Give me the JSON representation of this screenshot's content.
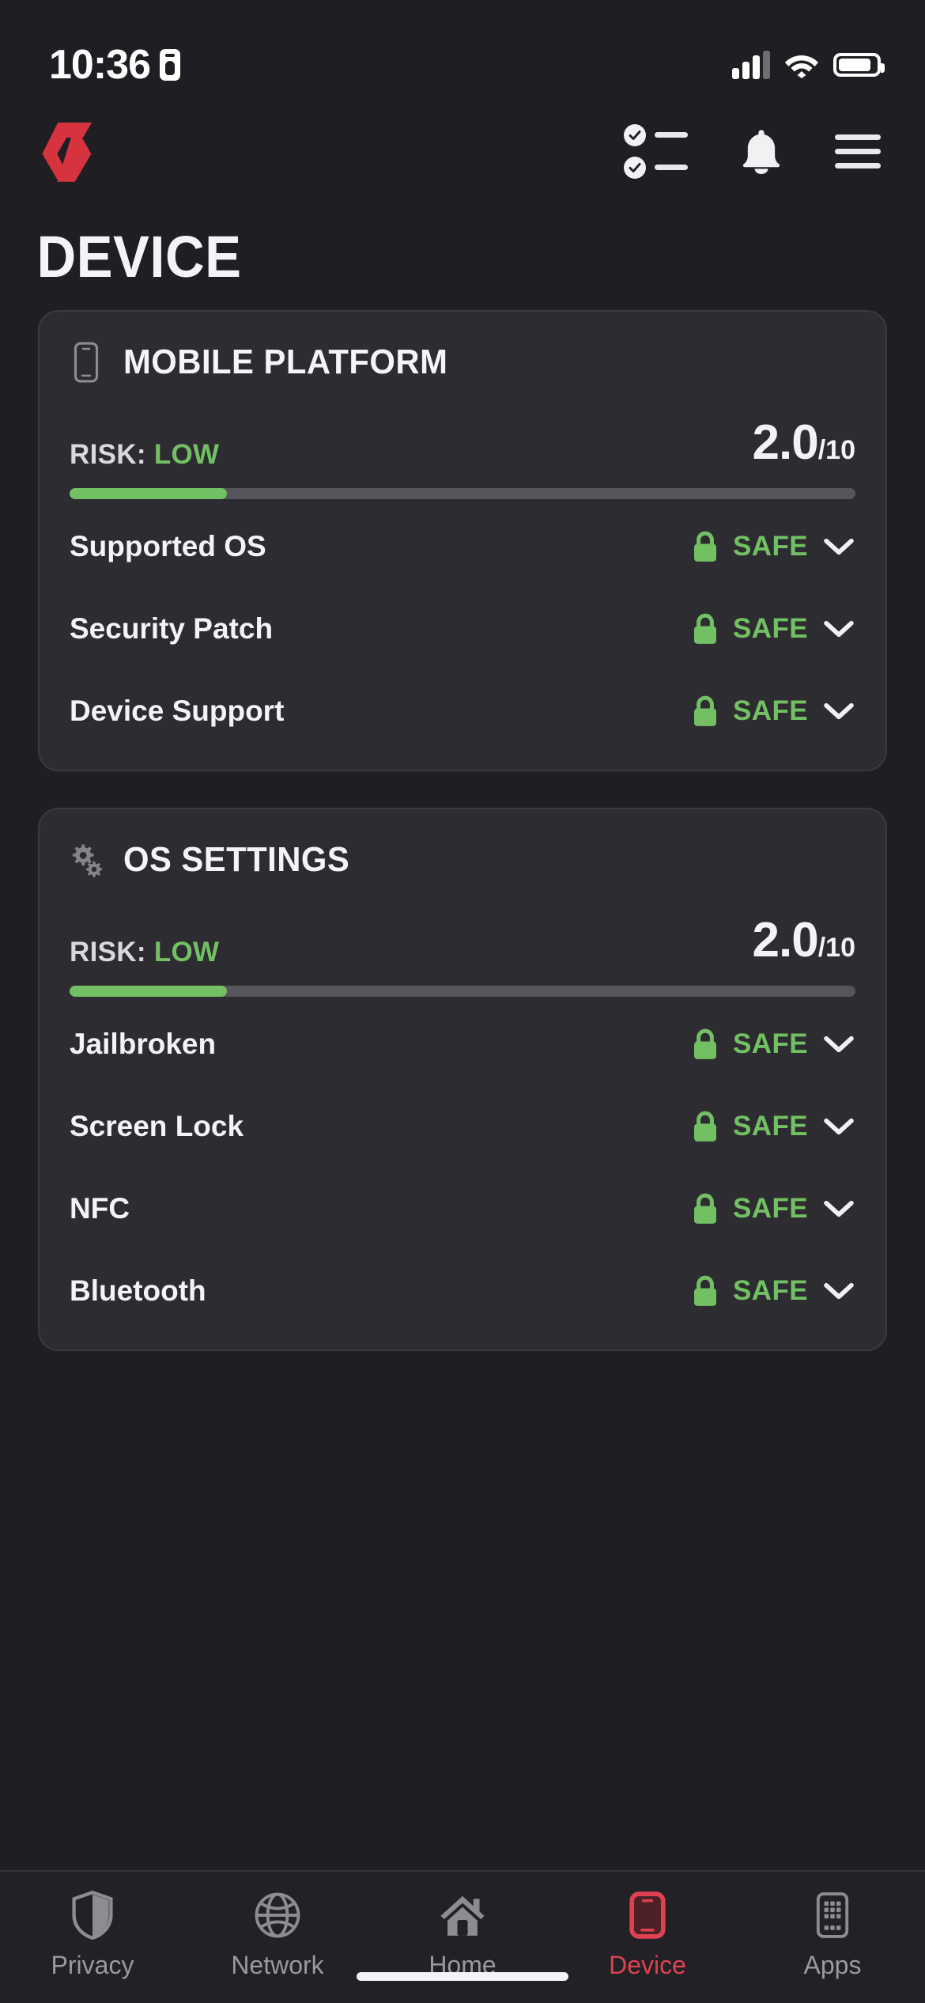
{
  "status_bar": {
    "time": "10:36",
    "badge_icon": "id-badge-icon",
    "signal_icon": "cellular-signal-icon",
    "wifi_icon": "wifi-icon",
    "battery_icon": "battery-icon"
  },
  "header": {
    "logo_icon": "app-logo-hexagon-icon",
    "logo_color": "#d6333f",
    "checklist_icon": "checklist-icon",
    "notifications_icon": "bell-icon",
    "menu_icon": "hamburger-menu-icon"
  },
  "page": {
    "title": "DEVICE"
  },
  "colors": {
    "background": "#1f1e23",
    "card": "#2d2c31",
    "card_border": "#3b3a40",
    "safe_green": "#72c063",
    "accent_red": "#de4250",
    "meter_track": "#56555b"
  },
  "cards": [
    {
      "icon": "smartphone-icon",
      "title": "MOBILE PLATFORM",
      "risk_prefix": "RISK:",
      "risk_level": "LOW",
      "score": "2.0",
      "score_denominator": "/10",
      "meter_percent": 20,
      "rows": [
        {
          "label": "Supported OS",
          "status": "SAFE",
          "status_icon": "lock-closed-icon",
          "expand_icon": "chevron-down-icon"
        },
        {
          "label": "Security Patch",
          "status": "SAFE",
          "status_icon": "lock-closed-icon",
          "expand_icon": "chevron-down-icon"
        },
        {
          "label": "Device Support",
          "status": "SAFE",
          "status_icon": "lock-closed-icon",
          "expand_icon": "chevron-down-icon"
        }
      ]
    },
    {
      "icon": "gears-icon",
      "title": "OS SETTINGS",
      "risk_prefix": "RISK:",
      "risk_level": "LOW",
      "score": "2.0",
      "score_denominator": "/10",
      "meter_percent": 20,
      "rows": [
        {
          "label": "Jailbroken",
          "status": "SAFE",
          "status_icon": "lock-closed-icon",
          "expand_icon": "chevron-down-icon"
        },
        {
          "label": "Screen Lock",
          "status": "SAFE",
          "status_icon": "lock-closed-icon",
          "expand_icon": "chevron-down-icon"
        },
        {
          "label": "NFC",
          "status": "SAFE",
          "status_icon": "lock-closed-icon",
          "expand_icon": "chevron-down-icon"
        },
        {
          "label": "Bluetooth",
          "status": "SAFE",
          "status_icon": "lock-closed-icon",
          "expand_icon": "chevron-down-icon"
        }
      ]
    }
  ],
  "tabbar": {
    "items": [
      {
        "label": "Privacy",
        "icon": "shield-icon",
        "active": false
      },
      {
        "label": "Network",
        "icon": "globe-icon",
        "active": false
      },
      {
        "label": "Home",
        "icon": "home-icon",
        "active": false
      },
      {
        "label": "Device",
        "icon": "phone-icon",
        "active": true
      },
      {
        "label": "Apps",
        "icon": "apps-grid-icon",
        "active": false
      }
    ]
  }
}
